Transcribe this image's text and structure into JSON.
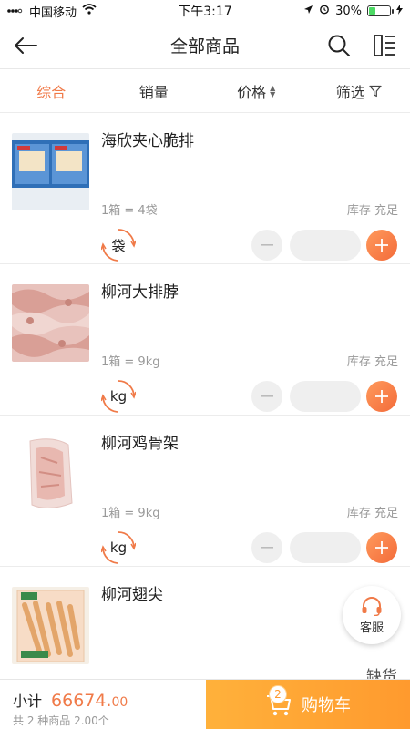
{
  "status_bar": {
    "carrier": "中国移动",
    "time": "下午3:17",
    "battery": "30%",
    "battery_level": 0.3
  },
  "nav": {
    "title": "全部商品",
    "back_icon": "arrow-left-icon",
    "search_icon": "search-icon",
    "layout_icon": "list-layout-icon"
  },
  "filters": {
    "comprehensive": "综合",
    "sales": "销量",
    "price": "价格",
    "filter": "筛选",
    "active_color": "#f07a48"
  },
  "products": [
    {
      "name": "海欣夹心脆排",
      "spec": "1箱 = 4袋",
      "stock": "库存 充足",
      "unit": "袋",
      "quantity": ""
    },
    {
      "name": "柳河大排脖",
      "spec": "1箱 = 9kg",
      "stock": "库存 充足",
      "unit": "kg",
      "quantity": ""
    },
    {
      "name": "柳河鸡骨架",
      "spec": "1箱 = 9kg",
      "stock": "库存 充足",
      "unit": "kg",
      "quantity": ""
    },
    {
      "name": "柳河翅尖"
    }
  ],
  "out_of_stock_label": "缺货",
  "service": {
    "label": "客服",
    "icon": "headset-icon"
  },
  "bottom_bar": {
    "subtotal_label": "小计",
    "subtotal_amount": "66674.",
    "subtotal_decimal": "00",
    "subtotal_detail": "共 2 种商品 2.00个",
    "cart_label": "购物车",
    "cart_count": "2",
    "cart_color": "#ff9a2e"
  }
}
